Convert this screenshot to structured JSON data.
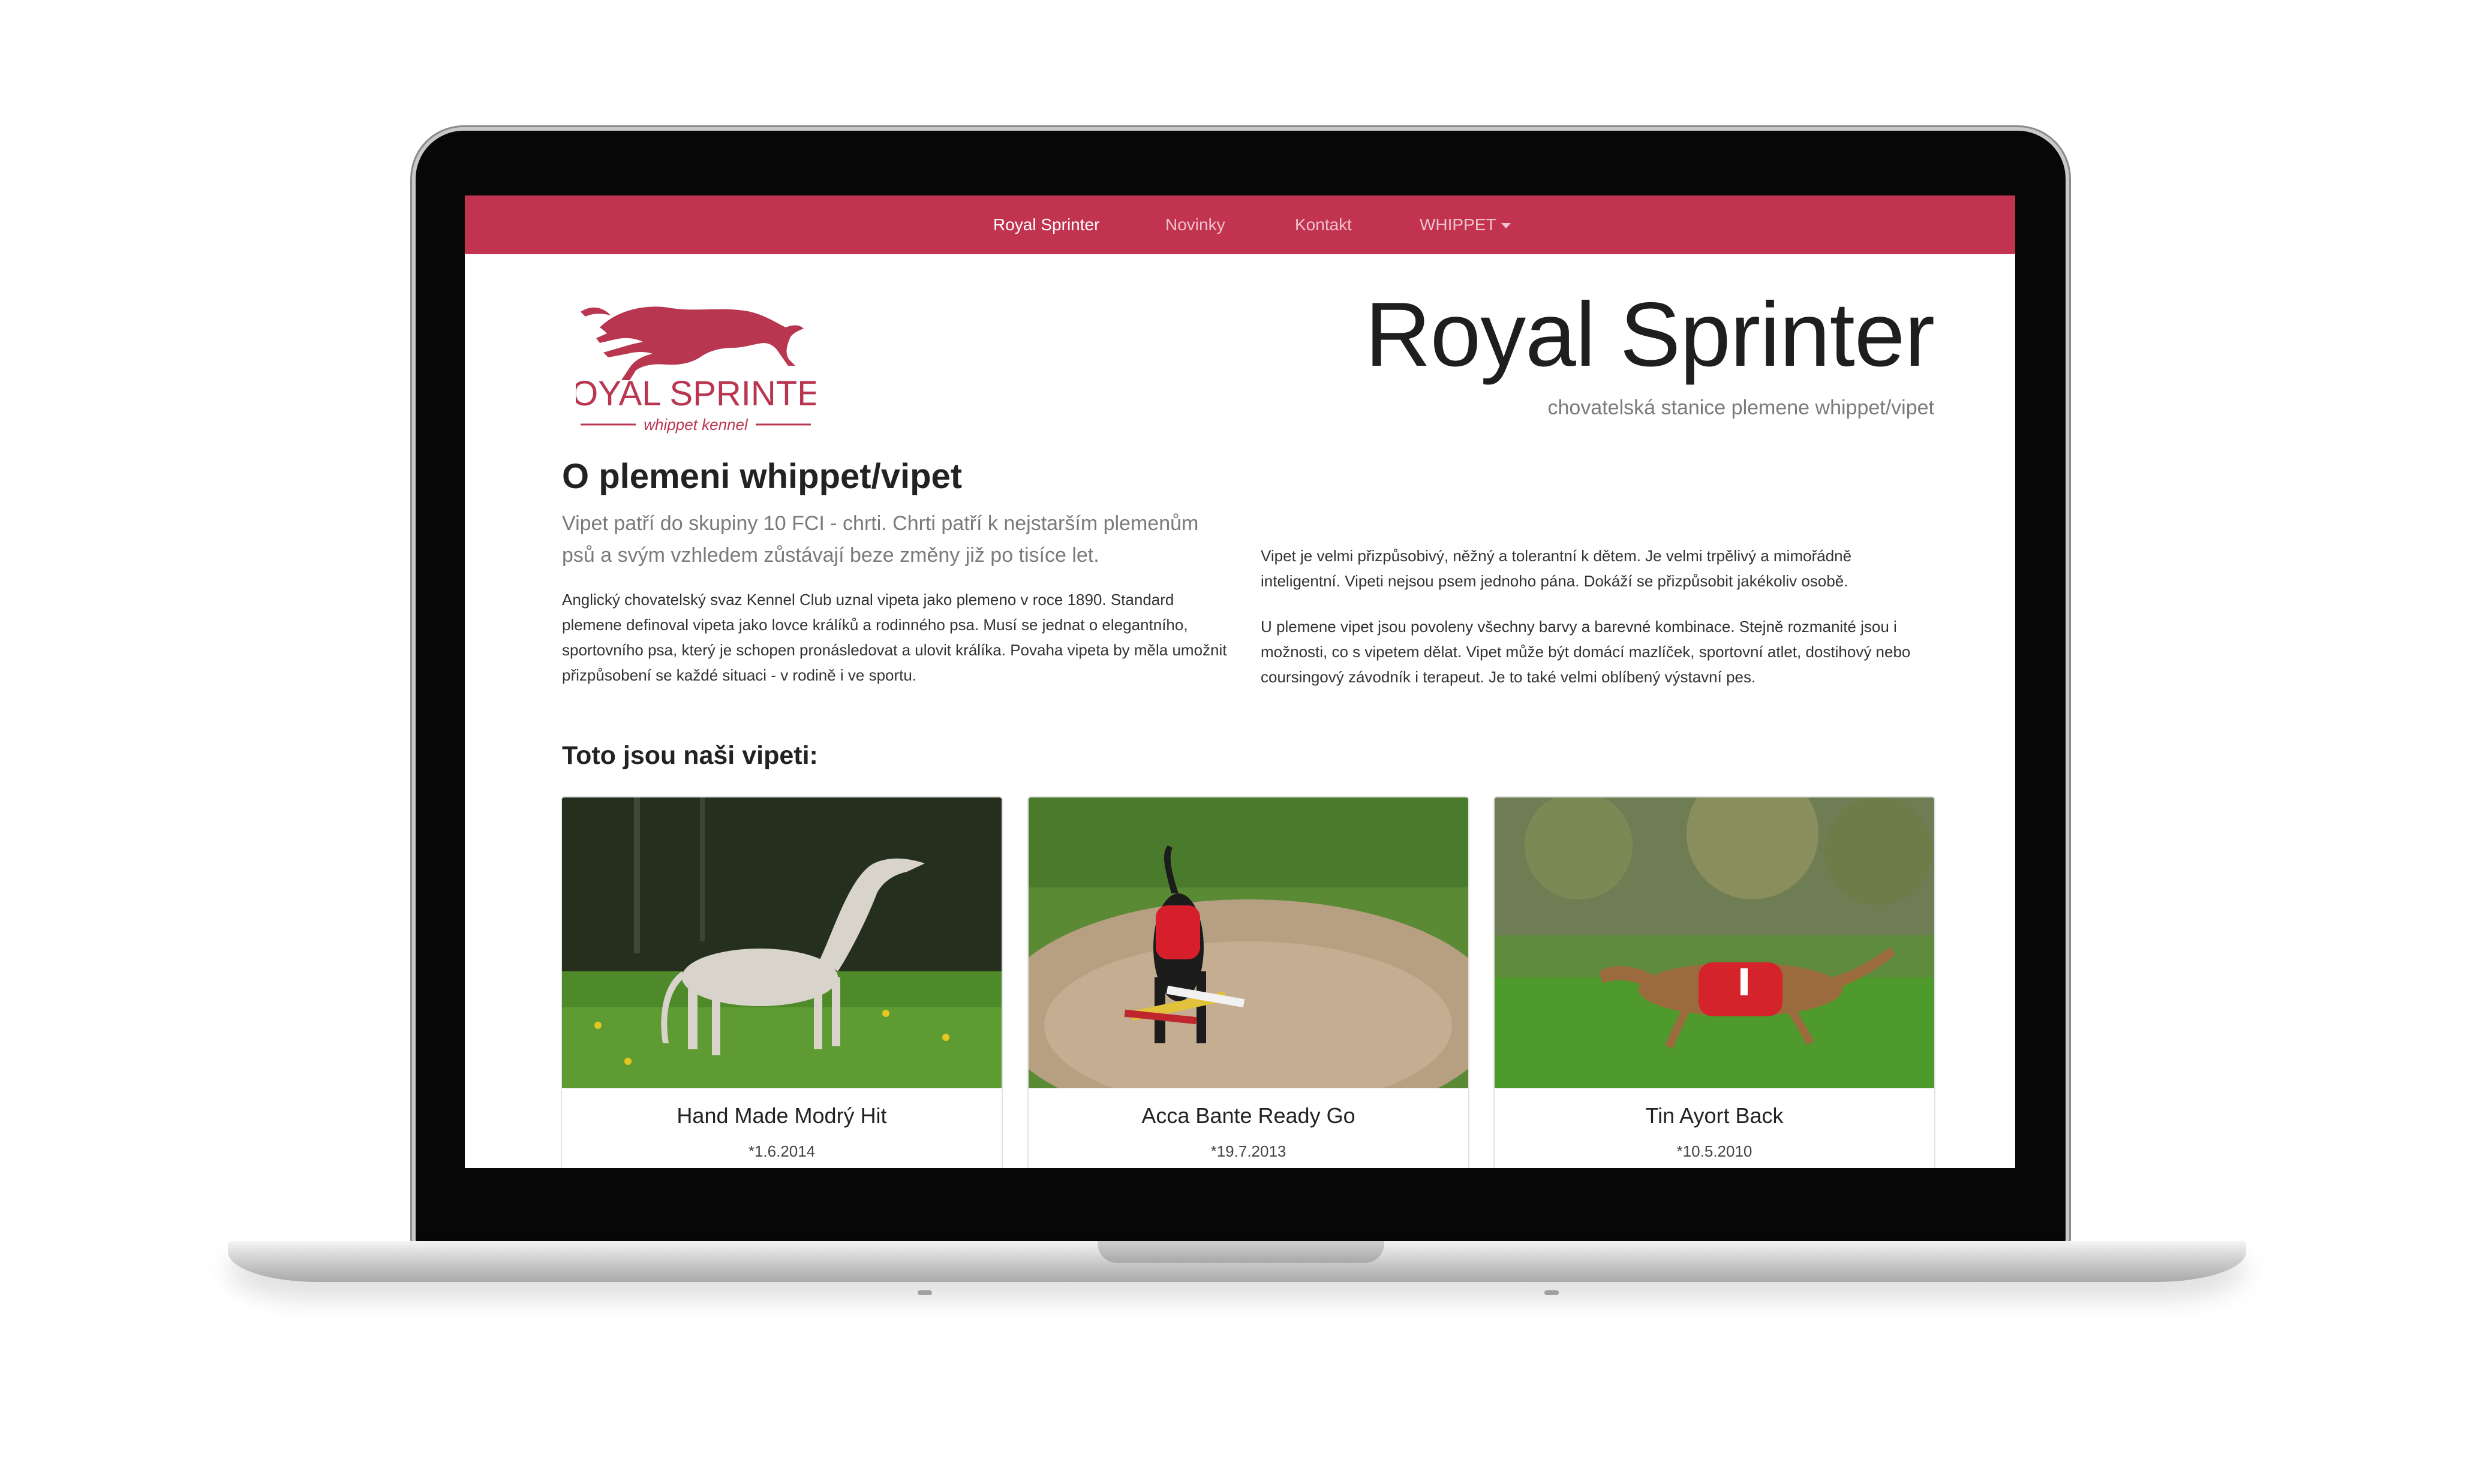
{
  "nav": {
    "items": [
      {
        "label": "Royal Sprinter",
        "active": true
      },
      {
        "label": "Novinky",
        "active": false
      },
      {
        "label": "Kontakt",
        "active": false
      }
    ],
    "dropdown_label": "WHIPPET"
  },
  "logo": {
    "name": "ROYAL SPRINTER",
    "tagline": "whippet kennel"
  },
  "header": {
    "title": "Royal Sprinter",
    "subtitle": "chovatelská stanice plemene whippet/vipet"
  },
  "about": {
    "heading": "O plemeni whippet/vipet",
    "lead": "Vipet patří do skupiny 10 FCI - chrti. Chrti patří k nejstarším plemenům psů a svým vzhledem zůstávají beze změny již po tisíce let.",
    "para1": "Anglický chovatelský svaz Kennel Club uznal vipeta jako plemeno v roce 1890. Standard plemene definoval vipeta jako lovce králíků a rodinného psa. Musí se jednat o elegantního, sportovního psa, který je schopen pronásledovat a ulovit králíka. Povaha vipeta by měla umožnit přizpůsobení se každé situaci - v rodině i ve sportu.",
    "para2": "Vipet je velmi přizpůsobivý, něžný a tolerantní k dětem. Je velmi trpělivý a mimořádně inteligentní. Vipeti nejsou psem jednoho pána. Dokáží se přizpůsobit jakékoliv osobě.",
    "para3": "U plemene vipet jsou povoleny všechny barvy a barevné kombinace. Stejně rozmanité jsou i možnosti, co s vipetem dělat. Vipet může být domácí mazlíček, sportovní atlet, dostihový nebo coursingový závodník i terapeut. Je to také velmi oblíbený výstavní pes."
  },
  "dogs": {
    "heading": "Toto jsou naši vipeti:",
    "cards": [
      {
        "name": "Hand Made Modrý Hit",
        "born": "*1.6.2014"
      },
      {
        "name": "Acca Bante Ready Go",
        "born": "*19.7.2013"
      },
      {
        "name": "Tin Ayort Back",
        "born": "*10.5.2010"
      }
    ]
  },
  "colors": {
    "brand": "#c1334f",
    "nav_inactive": "#eec3cd",
    "logo": "#b83650"
  }
}
